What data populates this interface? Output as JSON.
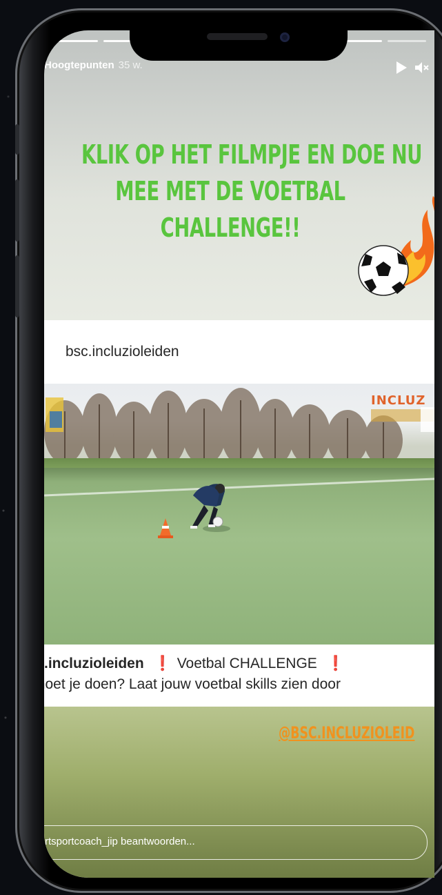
{
  "story": {
    "header": {
      "username": "Hoogtepunten",
      "time_ago": "35 w."
    },
    "progress_segments": 4,
    "title_lines": [
      "KLIK OP HET FILMPJE EN DOE NU",
      "MEE MET DE VOETBAL",
      "CHALLENGE!!"
    ],
    "shared_post": {
      "username": "bsc.incluzioleiden",
      "video_badge": "INCLUZ",
      "caption": {
        "username": ".incluzioleiden",
        "excl_left": "❗",
        "text": "Voetbal CHALLENGE",
        "excl_right": "❗",
        "line2": "moet je doen? Laat jouw voetbal skills zien door"
      }
    },
    "mention": "@BSC.INCLUZIOLEID",
    "reply": {
      "placeholder": "rtsportcoach_jip beantwoorden..."
    }
  },
  "colors": {
    "title_green": "#59c53e",
    "mention_orange": "#f0921e",
    "exclamation_red": "#e0221b"
  },
  "icons": [
    "play-icon",
    "mute-icon",
    "soccer-ball-fire-icon",
    "traffic-cone-icon"
  ]
}
